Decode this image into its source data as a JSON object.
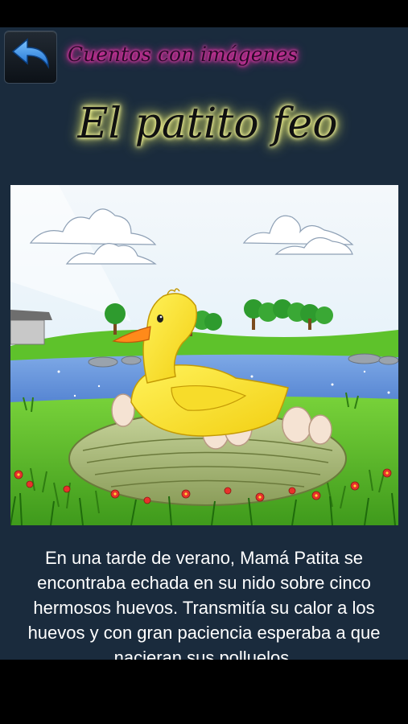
{
  "header": {
    "subtitle": "Cuentos con imágenes",
    "title": "El patito feo"
  },
  "story": {
    "text": "En una tarde de verano, Mamá Patita se encontraba echada en su nido sobre cinco hermosos huevos. Transmitía su calor a los huevos y con gran paciencia esperaba a que nacieran sus polluelos."
  },
  "icons": {
    "back": "back-arrow-icon"
  },
  "colors": {
    "background": "#1a2b3d",
    "subtitle_glow": "#e2219a",
    "title_glow": "#eef06e",
    "text": "#ffffff"
  }
}
